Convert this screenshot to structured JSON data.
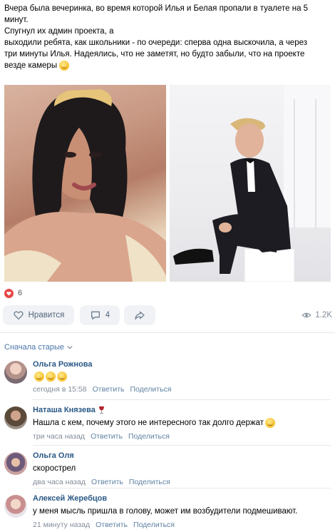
{
  "post": {
    "lines": [
      "Вчера была вечеринка, во время которой Илья и Белая пропали в туалете на 5",
      "минут.",
      "Спугнул их админ проекта, а",
      "выходили ребята, как школьники - по очереди: сперва одна выскочила, а через",
      "три минуты Илья. Надеялись, что не заметят, но будто забыли, что на проекте",
      "везде камеры"
    ],
    "emoji": "smiling-face-emoji"
  },
  "reactions": {
    "count": "6",
    "icon": "heart-icon",
    "color": "#e64646"
  },
  "actions": {
    "like_label": "Нравится",
    "comments_count": "4",
    "views": "1.2K"
  },
  "sort_label": "Сначала старые",
  "comments": [
    {
      "author": "Ольга Рожнова",
      "text": "",
      "emojis": [
        "emoji",
        "emoji",
        "emoji"
      ],
      "time": "сегодня в 15:58",
      "reply": "Ответить",
      "share": "Поделиться"
    },
    {
      "author": "Наташа Князева",
      "author_emoji": "wine-glass-icon",
      "text": "Нашла с кем, почему этого не интересного так долго держат",
      "emojis": [
        "emoji"
      ],
      "time": "три часа назад",
      "reply": "Ответить",
      "share": "Поделиться"
    },
    {
      "author": "Ольга Оля",
      "text": "скорострел",
      "time": "два часа назад",
      "reply": "Ответить",
      "share": "Поделиться"
    },
    {
      "author": "Алексей Жеребцов",
      "text": "у меня мысль пришла в голову, может им возбудители подмешивают.",
      "time": "21 минуту назад",
      "reply": "Ответить",
      "share": "Поделиться"
    }
  ],
  "colors": {
    "link": "#2a5885",
    "muted": "#818c99",
    "button_bg": "#f0f2f5"
  }
}
